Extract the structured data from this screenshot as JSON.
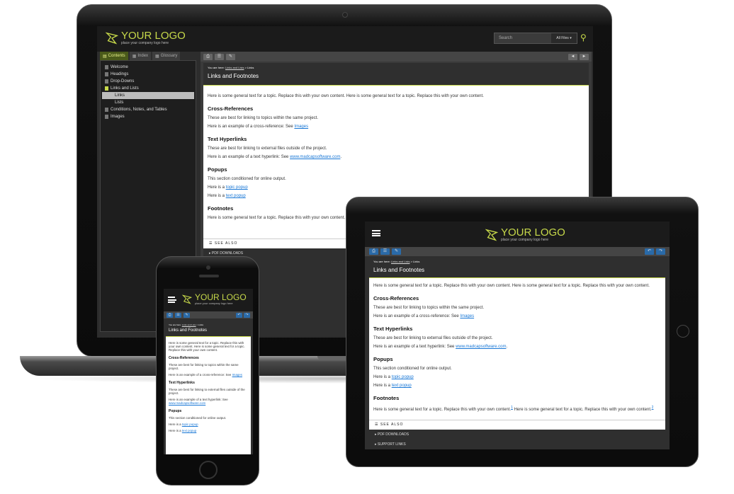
{
  "brand": {
    "logo_text": "YOUR LOGO",
    "logo_sub": "place your company logo here",
    "accent": "#c7d94a"
  },
  "search": {
    "placeholder": "Search",
    "filter": "All Files ▾"
  },
  "tabs": [
    {
      "label": "Contents",
      "icon": "book-icon"
    },
    {
      "label": "Index",
      "icon": "index-icon"
    },
    {
      "label": "Glossary",
      "icon": "glossary-icon"
    }
  ],
  "toc": [
    {
      "label": "Welcome",
      "level": 0
    },
    {
      "label": "Headings",
      "level": 0
    },
    {
      "label": "Drop-Downs",
      "level": 0
    },
    {
      "label": "Links and Lists",
      "level": 0
    },
    {
      "label": "Links",
      "level": 1,
      "selected": true
    },
    {
      "label": "Lists",
      "level": 1
    },
    {
      "label": "Conditions, Notes, and Tables",
      "level": 0
    },
    {
      "label": "Images",
      "level": 0
    }
  ],
  "breadcrumb": {
    "prefix": "You are here:",
    "link": "Links and Lists",
    "current": "> Links"
  },
  "topic": {
    "title": "Links and Footnotes",
    "intro": "Here is some general text for a topic. Replace this with your own content. Here is some general text for a topic. Replace this with your own content.",
    "xref_heading": "Cross-References",
    "xref_p1": "These are best for linking to topics within the same project.",
    "xref_p2": "Here is an example of a cross-reference: See",
    "xref_link": "Images",
    "hyper_heading": "Text Hyperlinks",
    "hyper_p1": "These are best for linking to external files outside of the project.",
    "hyper_p2": "Here is an example of a text hyperlink: See",
    "hyper_link": "www.madcapsoftware.com",
    "popups_heading": "Popups",
    "popups_p1": "This section conditioned for online output.",
    "popups_p2": "Here is a",
    "topic_popup": "topic popup",
    "text_popup": "text popup",
    "footnotes_heading": "Footnotes",
    "footnotes_p": "Here is some general text for a topic. Replace this with your own content.",
    "footnotes_p_rest": "Here is some general text for a topic. Replace this with your own content.",
    "fn1": "1",
    "fn2": "2"
  },
  "see_also": "SEE ALSO",
  "pdf_downloads": "▸  PDF DOWNLOADS",
  "support_links": "▸  SUPPORT LINKS",
  "phone_intro": "Here is some general text for a topic. Replace this with your own content. Here is some general text for a topic. Replace this with your own content.",
  "phone_hyper_p2": "Here is an example of a text hyperlink: See"
}
